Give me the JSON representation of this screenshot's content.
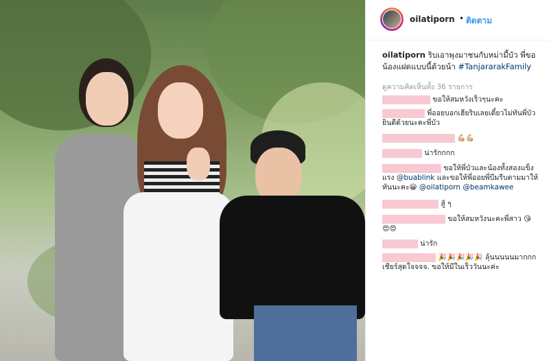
{
  "post": {
    "username": "oilatiporn",
    "separator": "•",
    "follow_label": "ติดตาม",
    "caption_user": "oilatiporn",
    "caption_text": "ริบเอาพุงมาชนกับหม่ามี้บัว พี่ขอน้องแฝดแบบนี้ด้วยน้า",
    "caption_tag": "#TanjararakFamily",
    "view_all_comments": "ดูความคิดเห็นทั้ง 36 รายการ"
  },
  "comments": [
    {
      "text": "ขอให้สมหวังเร็วๆนะคะ"
    },
    {
      "text": "พี่ออยบอกเฮียริบเลยเดี๋ยวไม่ทันพี่บัว ยินดีด้วยนะคะพี่บัว"
    },
    {
      "text": "💪🏼💪🏼"
    },
    {
      "text": "น่ารักกกก"
    },
    {
      "text": "ขอให้พี่บัวและน้องทั้งสองแข็งแรง",
      "mention1": "@buablink",
      "mid": "และขอให้พี่ออยพี่บีมรีบตามมาให้ทันนะคะ😀",
      "mention2": "@oilatiporn",
      "mention3": "@beamkawee"
    },
    {
      "text": "สู้ ๆ"
    },
    {
      "text": "ขอให้สมหวังนะคะพี่สาว 😘",
      "emoji": "😍😍"
    },
    {
      "text": "น่ารัก"
    },
    {
      "text": "🎉🎉🎉🎉🎉 ลุ้นนนนนมากกก เชียร์สุดใจจจจ. ขอให้มีในเร็ววันนะค่ะ"
    }
  ],
  "colors": {
    "link": "#3897f0",
    "mention": "#003569",
    "redact": "#f8c9d3"
  }
}
